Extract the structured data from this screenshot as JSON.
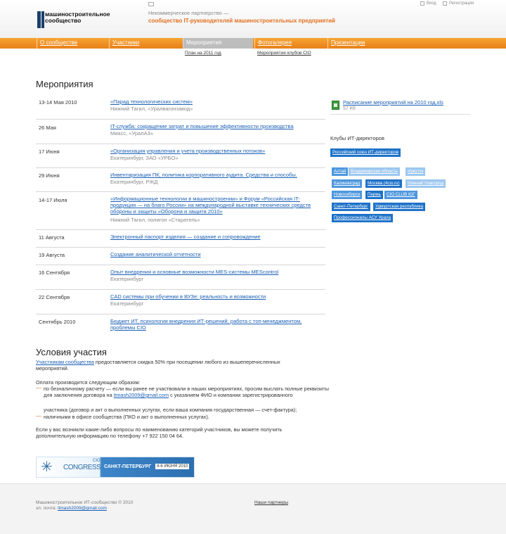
{
  "header": {
    "logo_text": "машиностроительное сообщество",
    "tagline_top": "Некоммерческое партнерство —",
    "tagline_main": "сообщество IT-руководителей машиностроительных предприятий",
    "login": "Вход",
    "register": "Регистрация"
  },
  "nav": {
    "items": [
      {
        "label": "О сообществе"
      },
      {
        "label": "Участники"
      },
      {
        "label": "Мероприятия"
      },
      {
        "label": "Фотогалерея"
      },
      {
        "label": "Презентации"
      }
    ],
    "sub_events": "План на 2011 год",
    "sub_gallery": "Мероприятия клубов CIO"
  },
  "main": {
    "title": "Мероприятия",
    "events": [
      {
        "date": "13-14 Мая 2010",
        "title": "«Парад технологических систем»",
        "location": "Нижний Тагил, «Уралвагонзавод»"
      },
      {
        "date": "26 Мая",
        "title": "IT-служба: сокращение затрат и повышение эффективности производства",
        "location": "Миасс, «УралАЗ»"
      },
      {
        "date": "17 Июня",
        "title": "«Организация управления и учета производственных потоков»",
        "location": "Екатеринбург, ЗАО «УРБО»"
      },
      {
        "date": "29 Июня",
        "title": "Инвентаризация ПК, политика корпоративного аудита. Средства и способы.",
        "location": "Екатеринбург, РЖД"
      },
      {
        "date": "14-17 Июля",
        "title": "«Информационные технологии в машиностроении» и  Форум «Российская IT-продукция — на благо России» на международной выставке технических средств обороны и защиты «Оборона и защита 2010»",
        "location": "Нижний Тагил, полигон «Старатель»"
      },
      {
        "date": "11 Августа",
        "title": "Электронный паспорт изделия — создание и сопровождение",
        "location": ""
      },
      {
        "date": "19 Августа",
        "title": "Создание аналитической отчетности",
        "location": ""
      },
      {
        "date": "16 Сентября",
        "title": "Опыт внедрения и основные возможности MES-системы MEScontrol",
        "location": "Екатеринбург"
      },
      {
        "date": "22 Сентября",
        "title": "CAD системы при обучении в ВУЗе: реальность и возможности",
        "location": "Екатеринбург"
      },
      {
        "date": "Сентябрь 2010",
        "title": "Бюджет ИТ, психология внедрения ИТ-решений, работа с топ-менеджментом, проблемы CIO",
        "location": ""
      }
    ],
    "conditions_title": "Условия участия",
    "cond_link": "Участникам сообщества",
    "cond_text": " предоставляется скидка 50% при посещении любого из вышеперечисленных мероприятий.",
    "payment_intro": "Оплата производится следующим образом:",
    "bullet1_a": "по безналичному расчету — если вы ранее не участвовали в наших мероприятиях, просим выслать полные реквизиты для заключения договора на ",
    "bullet1_email": "itmash2009@gmail.com",
    "bullet1_b": " с указанием ФИО и компании зарегистрированного",
    "bullet1_c": "участника (договор и акт о выполненных услугах, если ваша компания государственная — счет-фактура);",
    "bullet2": "наличными в офисе сообщества (ПКО и акт о выполненных услугах).",
    "contact": "Если у вас возникли какие-либо вопросы по наименованию категорий участников, вы можете получить дополнительную информацию по телефону +7 922 150 04 64."
  },
  "banner": {
    "cio": "CIO",
    "congress": "CONGRESS",
    "city": "САНКТ-ПЕТЕРБУРГ",
    "date": "4-6 ИЮНЯ 2010"
  },
  "sidebar": {
    "file_label": "Расписание мероприятий на 2010 год.xls",
    "file_size": "57 Кб",
    "clubs_title": "Клубы ИТ-директоров",
    "main_club": "Российский союз ИТ-директоров",
    "clubs": [
      {
        "label": "Алтай"
      },
      {
        "label": "Владимирская область"
      },
      {
        "label": "Иркутск"
      },
      {
        "label": "Калининград"
      },
      {
        "label": "Москва (4cio.ru)"
      },
      {
        "label": "Нижний Новгород"
      },
      {
        "label": "Новосибирск"
      },
      {
        "label": "Пермь"
      },
      {
        "label": "CIO CLUB ЮГ"
      },
      {
        "label": "Санкт-Петербург"
      },
      {
        "label": "Удмуртская республика"
      },
      {
        "label": "Профессионалы АСУ Урала"
      }
    ]
  },
  "footer": {
    "copyright": "Машиностроительное ИТ-сообщество © 2010",
    "email_label": "эл. почта: ",
    "email": "itmash2009@gmail.com",
    "partners": "Наши партнеры"
  },
  "colors": {
    "accent": "#e8801a",
    "link": "#1a5fb4",
    "club_dark": "#1e72c8",
    "club_mid": "#4d97de",
    "club_light": "#9cc7ef"
  }
}
